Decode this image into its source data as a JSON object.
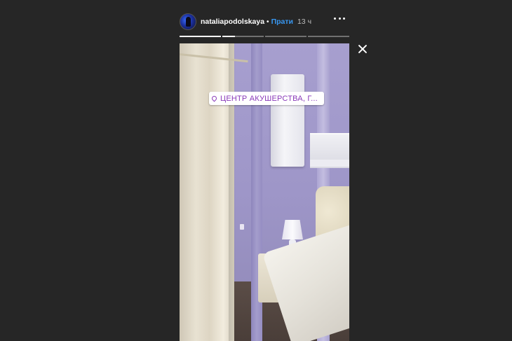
{
  "header": {
    "username": "nataliapodolskaya",
    "separator": "•",
    "follow_label": "Прати",
    "time": "13 ч",
    "more_icon": "more-horizontal-icon",
    "avatar_icon": "avatar"
  },
  "progress": {
    "segments": [
      1.0,
      0.3,
      0.0,
      0.0
    ]
  },
  "close_icon": "close-icon",
  "story": {
    "location_sticker": "ЦЕНТР АКУШЕРСТВА, Г...",
    "location_icon": "location-pin-icon"
  },
  "colors": {
    "background": "#262626",
    "follow": "#3897f0",
    "location_text": "#8a3ab9"
  }
}
